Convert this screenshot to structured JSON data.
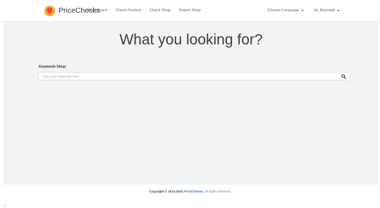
{
  "navbar": {
    "brand": "PriceChecks",
    "links": [
      "Dashboard",
      "Check Product",
      "Check Shop",
      "Report Shop"
    ],
    "language_label": "Choose Language",
    "user_label": "Hi, Reynaldi"
  },
  "main": {
    "headline": "What you looking for?",
    "keywords_label": "Keywords Shop:",
    "search_placeholder": "Type your keywords here"
  },
  "footer": {
    "prefix": "Copyright © 2014-2021",
    "brand": "PriceChecks.",
    "suffix": "All rights reserved."
  },
  "colors": {
    "accent": "#1a73e8",
    "background": "#f1f3f5",
    "logo": "#f4a52b"
  },
  "icons": [
    "logo-icon",
    "search-icon",
    "caret-down-icon"
  ]
}
